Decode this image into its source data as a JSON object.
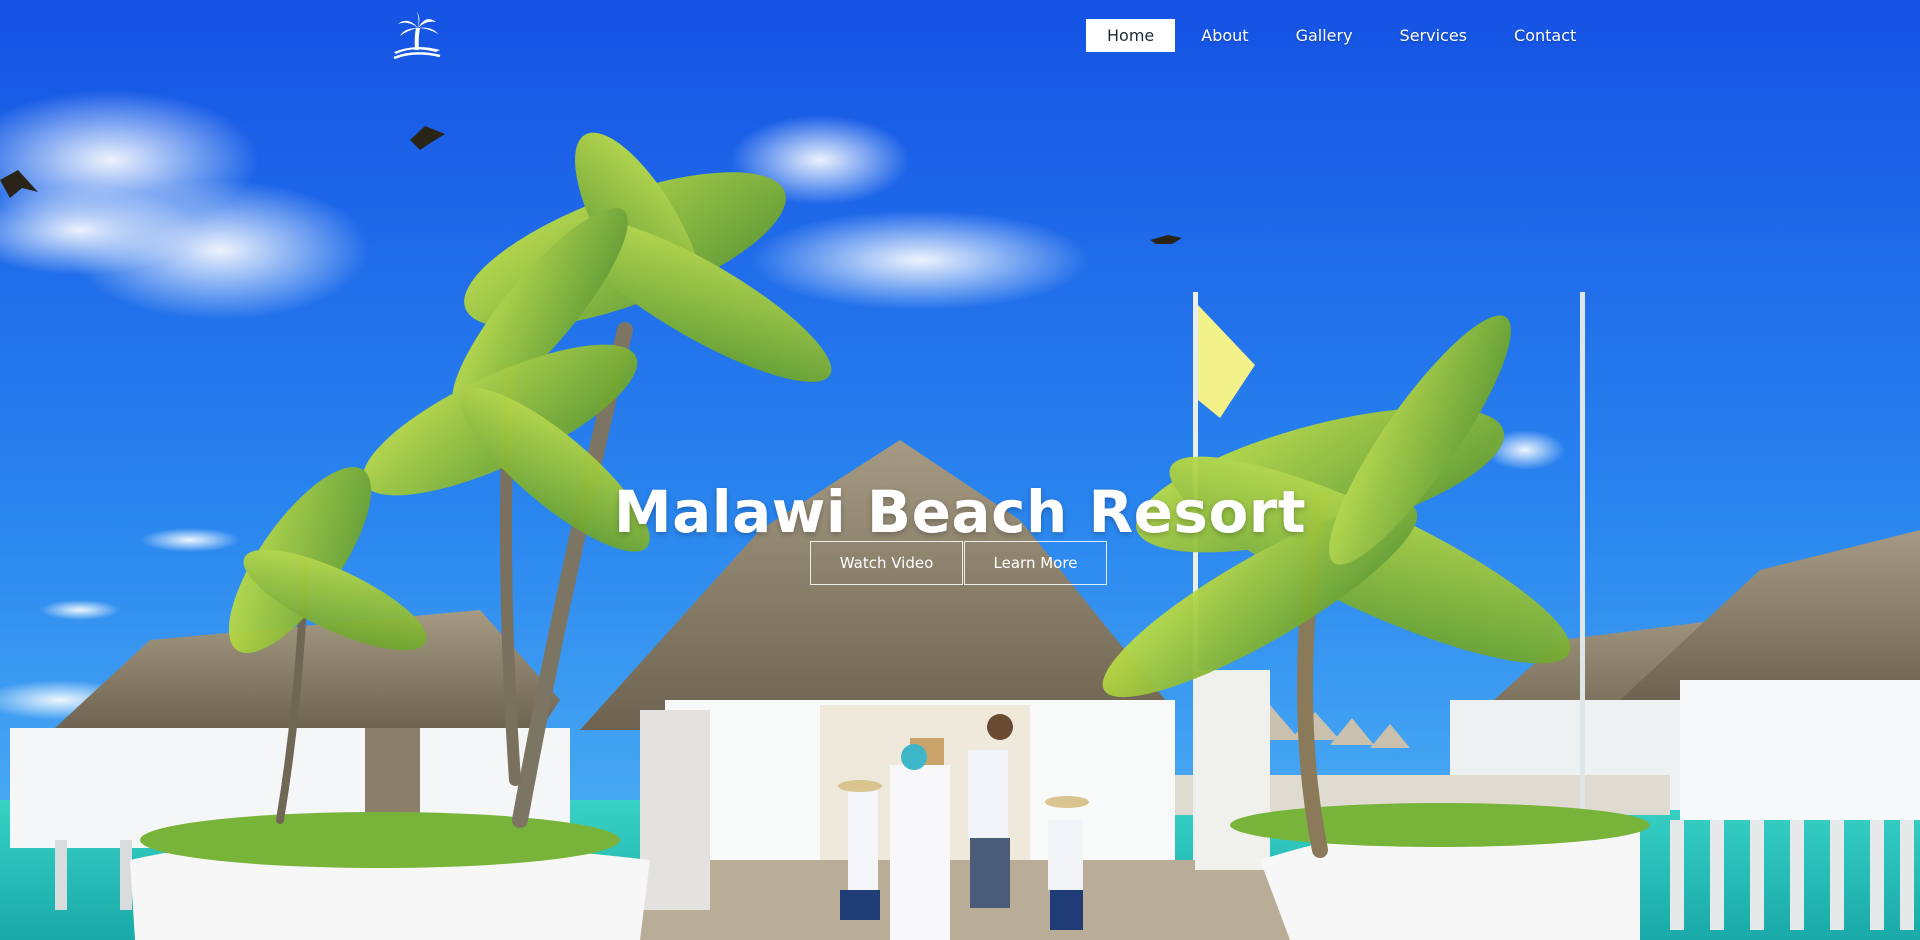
{
  "site": {
    "logo_icon": "palm-tree-logo-icon"
  },
  "nav": {
    "items": [
      {
        "label": "Home",
        "active": true
      },
      {
        "label": "About",
        "active": false
      },
      {
        "label": "Gallery",
        "active": false
      },
      {
        "label": "Services",
        "active": false
      },
      {
        "label": "Contact",
        "active": false
      }
    ]
  },
  "hero": {
    "title": "Malawi Beach Resort",
    "watch_video_label": "Watch Video",
    "learn_more_label": "Learn More",
    "background": "beach-resort-photo"
  },
  "colors": {
    "sky_top": "#1656e6",
    "sky_bottom": "#3fa2f2",
    "water": "#2fc6c0",
    "nav_active_bg": "#ffffff",
    "text": "#ffffff"
  }
}
